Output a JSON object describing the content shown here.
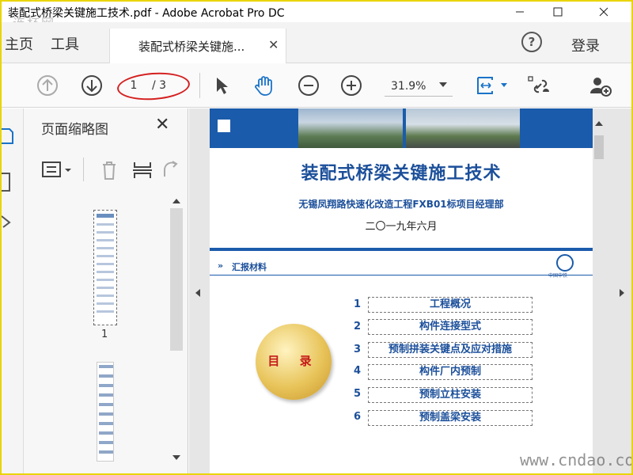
{
  "window": {
    "title": "装配式桥梁关键施工技术.pdf - Adobe Acrobat Pro DC",
    "watermark_top": "连杯网"
  },
  "nav": {
    "home": "主页",
    "tools": "工具",
    "doc_tab_label": "装配式桥梁关键施...",
    "help": "?",
    "login": "登录"
  },
  "toolbar": {
    "current_page": "1",
    "total_pages": "/ 3",
    "zoom": "31.9%",
    "highlight_color": "#d52020"
  },
  "thumbnails_panel": {
    "title": "页面缩略图",
    "thumb1_label": "1"
  },
  "document": {
    "title": "装配式桥梁关键施工技术",
    "subtitle": "无锡凤翔路快速化改造工程FXB01标项目经理部",
    "date": "二〇一九年六月",
    "section": "汇报材料",
    "section_arrow": "»",
    "logo_text": "中国中铁",
    "toc_label": "目 录",
    "toc": [
      {
        "num": "1",
        "label": "工程概况"
      },
      {
        "num": "2",
        "label": "构件连接型式"
      },
      {
        "num": "3",
        "label": "预制拼装关键点及应对措施"
      },
      {
        "num": "4",
        "label": "构件厂内预制"
      },
      {
        "num": "5",
        "label": "预制立柱安装"
      },
      {
        "num": "6",
        "label": "预制盖梁安装"
      }
    ],
    "accent_color": "#1b5bab"
  },
  "watermark_bottom": "www.cndao.com"
}
